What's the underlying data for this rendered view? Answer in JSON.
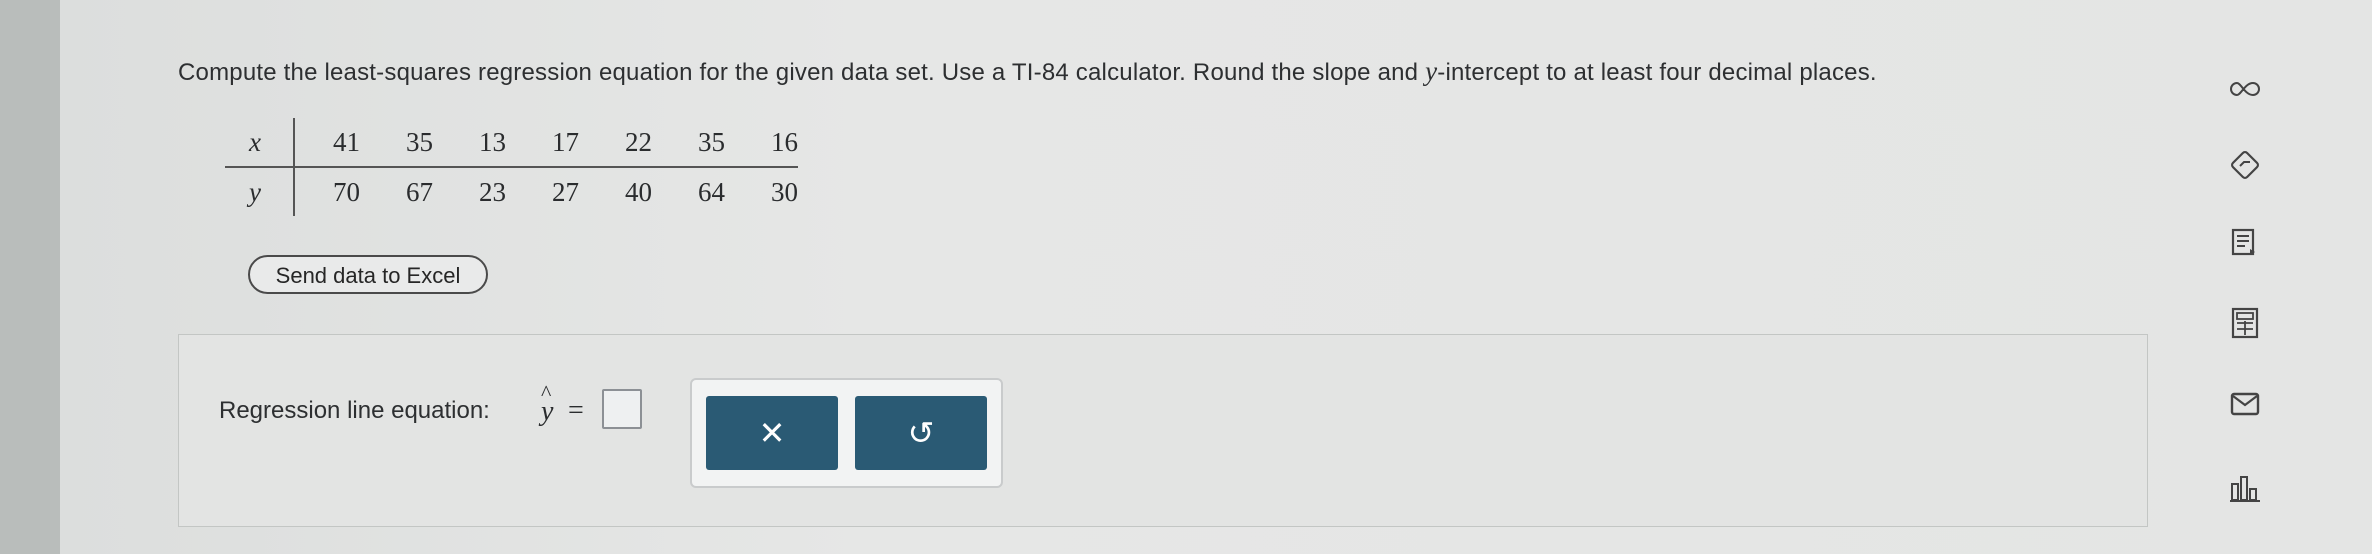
{
  "question": {
    "text_before": "Compute the least-squares regression equation for the given data set. Use a TI-84 calculator. Round the slope and ",
    "var_y": "y",
    "text_after": "-intercept to at least four decimal places."
  },
  "table": {
    "x_label": "x",
    "y_label": "y",
    "x_values": [
      "41",
      "35",
      "13",
      "17",
      "22",
      "35",
      "16"
    ],
    "y_values": [
      "70",
      "67",
      "23",
      "27",
      "40",
      "64",
      "30"
    ]
  },
  "excel_button": {
    "label": "Send data to Excel"
  },
  "answer": {
    "label": "Regression line equation:",
    "hat": "^",
    "y": "y",
    "equals": "=",
    "value": ""
  },
  "buttons": {
    "clear_symbol": "✕",
    "undo_symbol": "↺"
  },
  "sidebar_icons": [
    "infinity-icon",
    "hint-icon",
    "textbook-icon",
    "calculator-icon",
    "mail-icon",
    "chart-icon"
  ]
}
